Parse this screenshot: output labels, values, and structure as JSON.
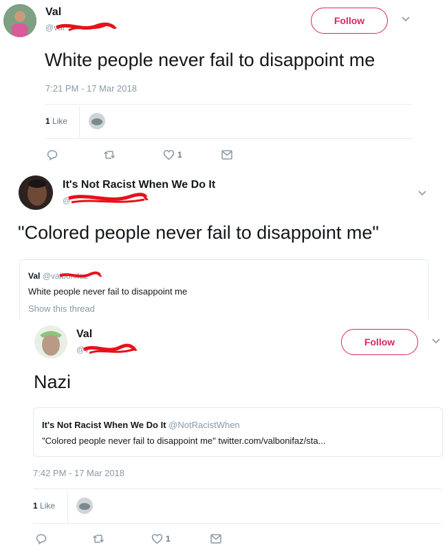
{
  "tweet1": {
    "name": "Val",
    "handle": "@val",
    "follow_label": "Follow",
    "text": "White people never fail to disappoint me",
    "timestamp": "7:21 PM - 17 Mar 2018",
    "likes_count": "1",
    "likes_label": "Like",
    "heart_count": "1"
  },
  "tweet2": {
    "name": "It's Not Racist When We Do It",
    "handle": "@",
    "text": "\"Colored people never fail to disappoint me\"",
    "quote": {
      "name": "Val",
      "handle": "@valbonifaz",
      "text": "White people never fail to disappoint me",
      "show_thread": "Show this thread"
    }
  },
  "tweet3": {
    "name": "Val",
    "handle": "@v",
    "follow_label": "Follow",
    "text": "Nazi",
    "quote": {
      "name": "It's Not Racist When We Do It",
      "handle": "@NotRacistWhen",
      "text": "\"Colored people never fail to disappoint me\" twitter.com/valbonifaz/sta..."
    },
    "timestamp": "7:42 PM - 17 Mar 2018",
    "likes_count": "1",
    "likes_label": "Like",
    "heart_count": "1"
  },
  "colors": {
    "follow": "#e0245e",
    "redaction": "#e8101a",
    "muted": "#8899a6"
  },
  "icons": [
    "reply-icon",
    "retweet-icon",
    "heart-icon",
    "message-icon",
    "chevron-down-icon"
  ]
}
